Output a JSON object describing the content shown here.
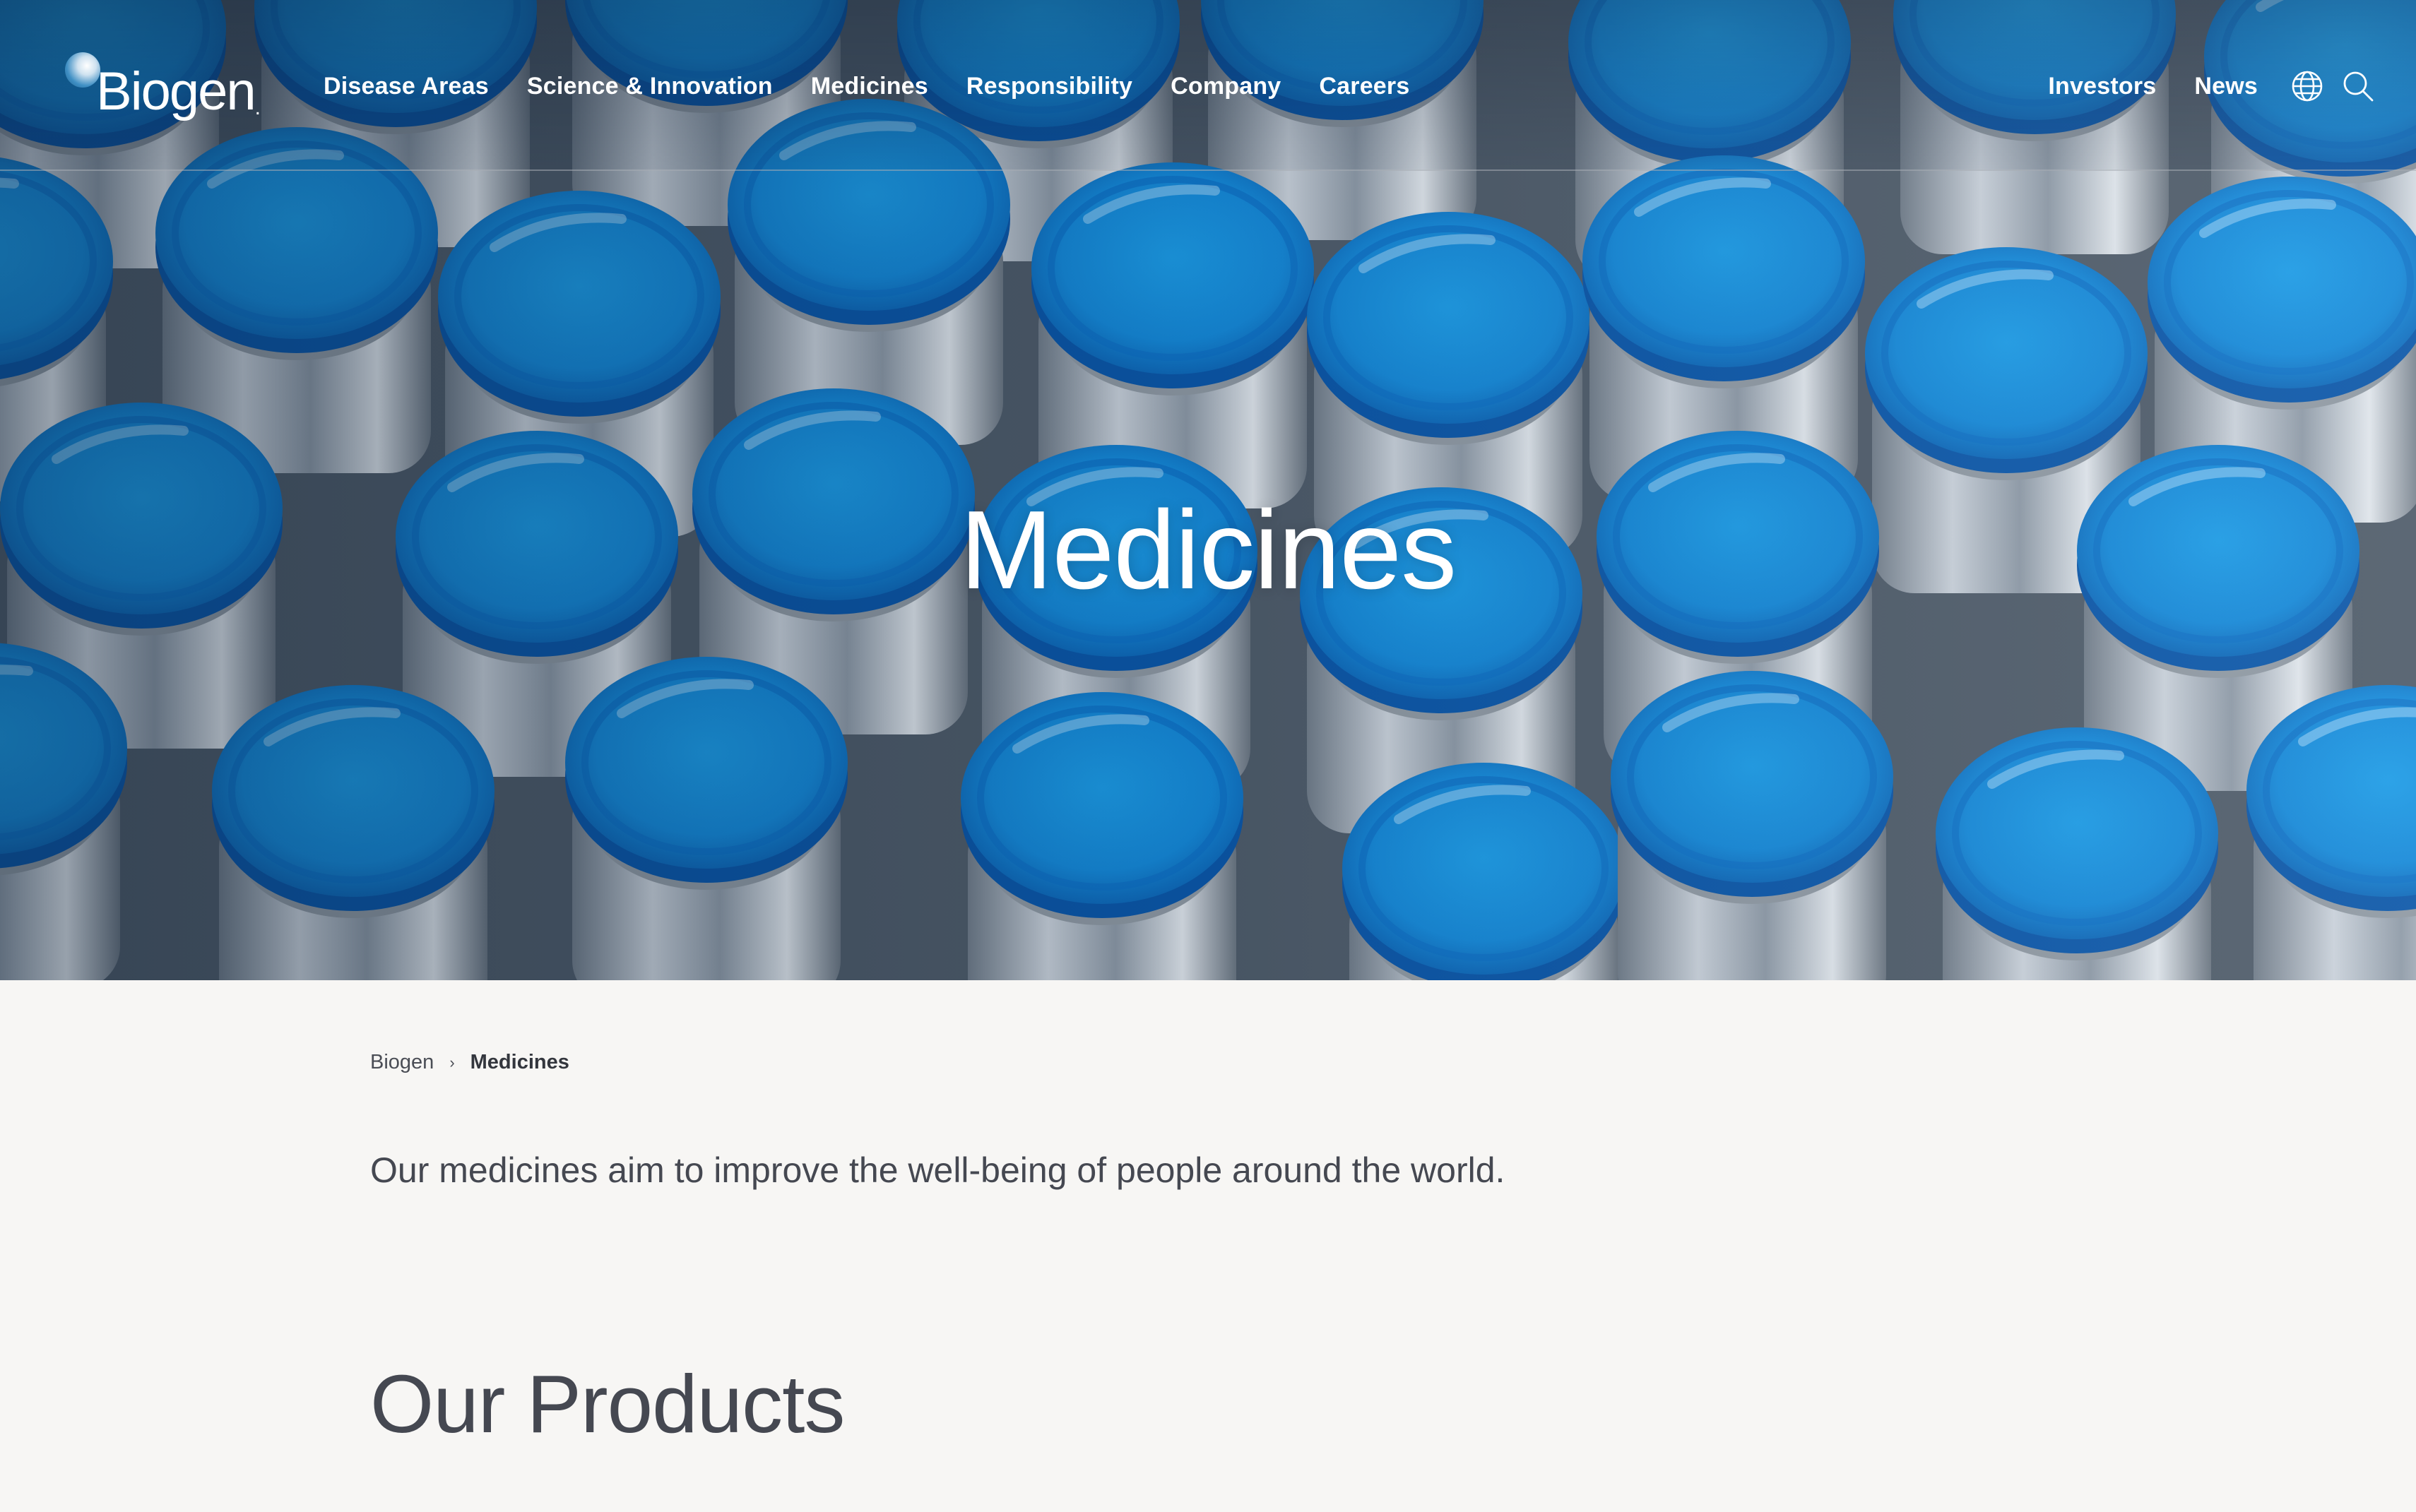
{
  "header": {
    "logo_text": "Biogen",
    "logo_dot": ".",
    "nav_main": [
      "Disease Areas",
      "Science & Innovation",
      "Medicines",
      "Responsibility",
      "Company",
      "Careers"
    ],
    "nav_right": [
      "Investors",
      "News"
    ],
    "icons": [
      "globe-icon",
      "search-icon"
    ]
  },
  "hero": {
    "title": "Medicines",
    "background": "glass-vials-blue-caps-photo"
  },
  "breadcrumb": {
    "home": "Biogen",
    "separator": "›",
    "current": "Medicines"
  },
  "main": {
    "intro": "Our medicines aim to improve the well-being of people around the world.",
    "section_title": "Our Products"
  },
  "colors": {
    "page_background": "#f7f6f4",
    "text_dark": "#454851",
    "nav_text": "#ffffff",
    "vial_cap_blue": "#1a8fe0"
  }
}
